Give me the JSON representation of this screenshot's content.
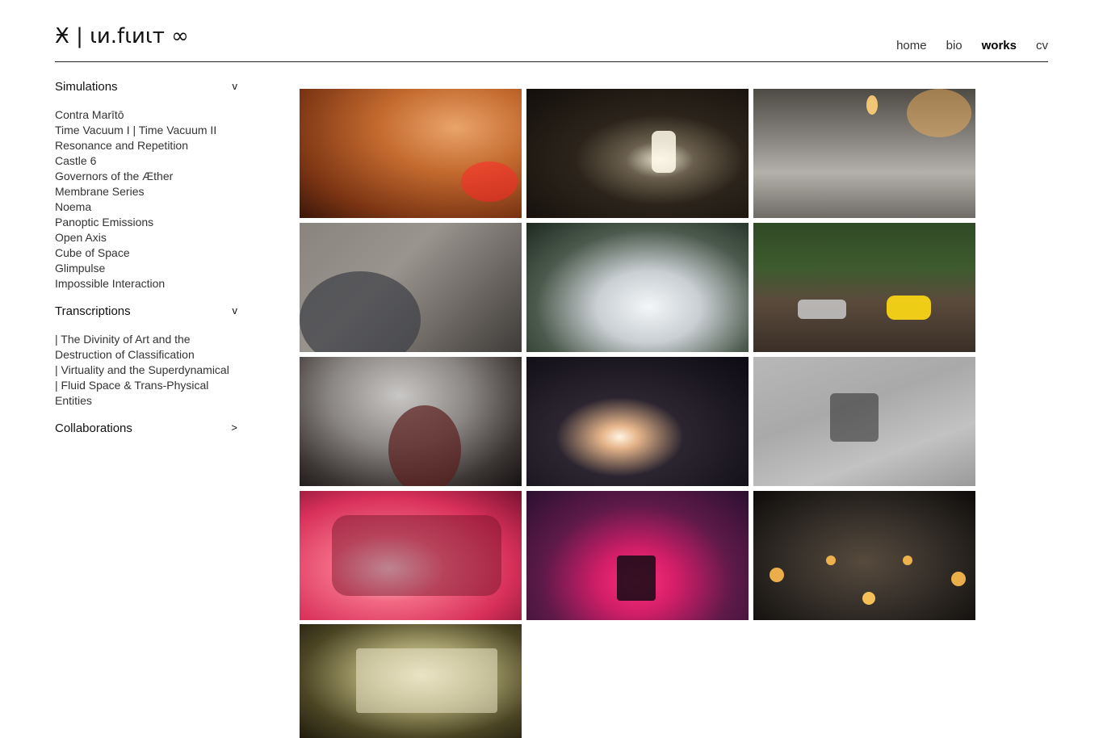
{
  "header": {
    "logo_text": "Ӿ | ɩи.fɩиɩт ∞",
    "nav": [
      {
        "label": "home",
        "active": false
      },
      {
        "label": "bio",
        "active": false
      },
      {
        "label": "works",
        "active": true
      },
      {
        "label": "cv",
        "active": false
      }
    ]
  },
  "sidebar": {
    "simulations": {
      "title": "Simulations",
      "chevron": "v",
      "items": [
        "Contra Marītō",
        "Time Vacuum I | Time Vacuum II",
        "Resonance and Repetition",
        "Castle 6",
        "Governors of the Æther",
        "Membrane Series",
        "Noema",
        "Panoptic Emissions",
        "Open Axis",
        "Cube of Space",
        "Glimpulse",
        "Impossible Interaction"
      ]
    },
    "transcriptions": {
      "title": "Transcriptions",
      "chevron": "v",
      "items": [
        "| The Divinity of Art and the Destruction of Classification",
        "| Virtuality and the Superdynamical",
        "| Fluid Space & Trans-Physical Entities"
      ]
    },
    "collaborations": {
      "title": "Collaborations",
      "chevron": ">"
    }
  },
  "gallery": {
    "colors": {
      "background": "#ffffff",
      "text": "#111111"
    }
  }
}
